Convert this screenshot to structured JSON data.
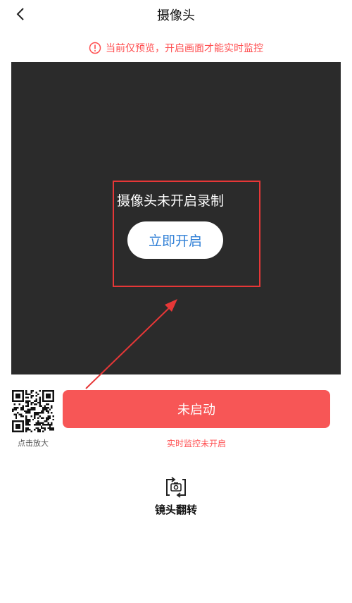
{
  "header": {
    "title": "摄像头",
    "back_icon": "chevron-left-icon"
  },
  "warning": {
    "icon": "exclamation-circle-icon",
    "text": "当前仅预览，开启画面才能实时监控",
    "color": "#ff4d4f"
  },
  "preview": {
    "status_text": "摄像头未开启录制",
    "open_button": "立即开启",
    "background": "#2b2b2b"
  },
  "qr": {
    "caption": "点击放大",
    "icon": "qr-code-icon"
  },
  "action": {
    "button_label": "未启动",
    "status_text": "实时监控未开启",
    "color": "#f75656"
  },
  "flip": {
    "label": "镜头翻转",
    "icon": "camera-flip-icon"
  },
  "annotation": {
    "color": "#e63737"
  }
}
